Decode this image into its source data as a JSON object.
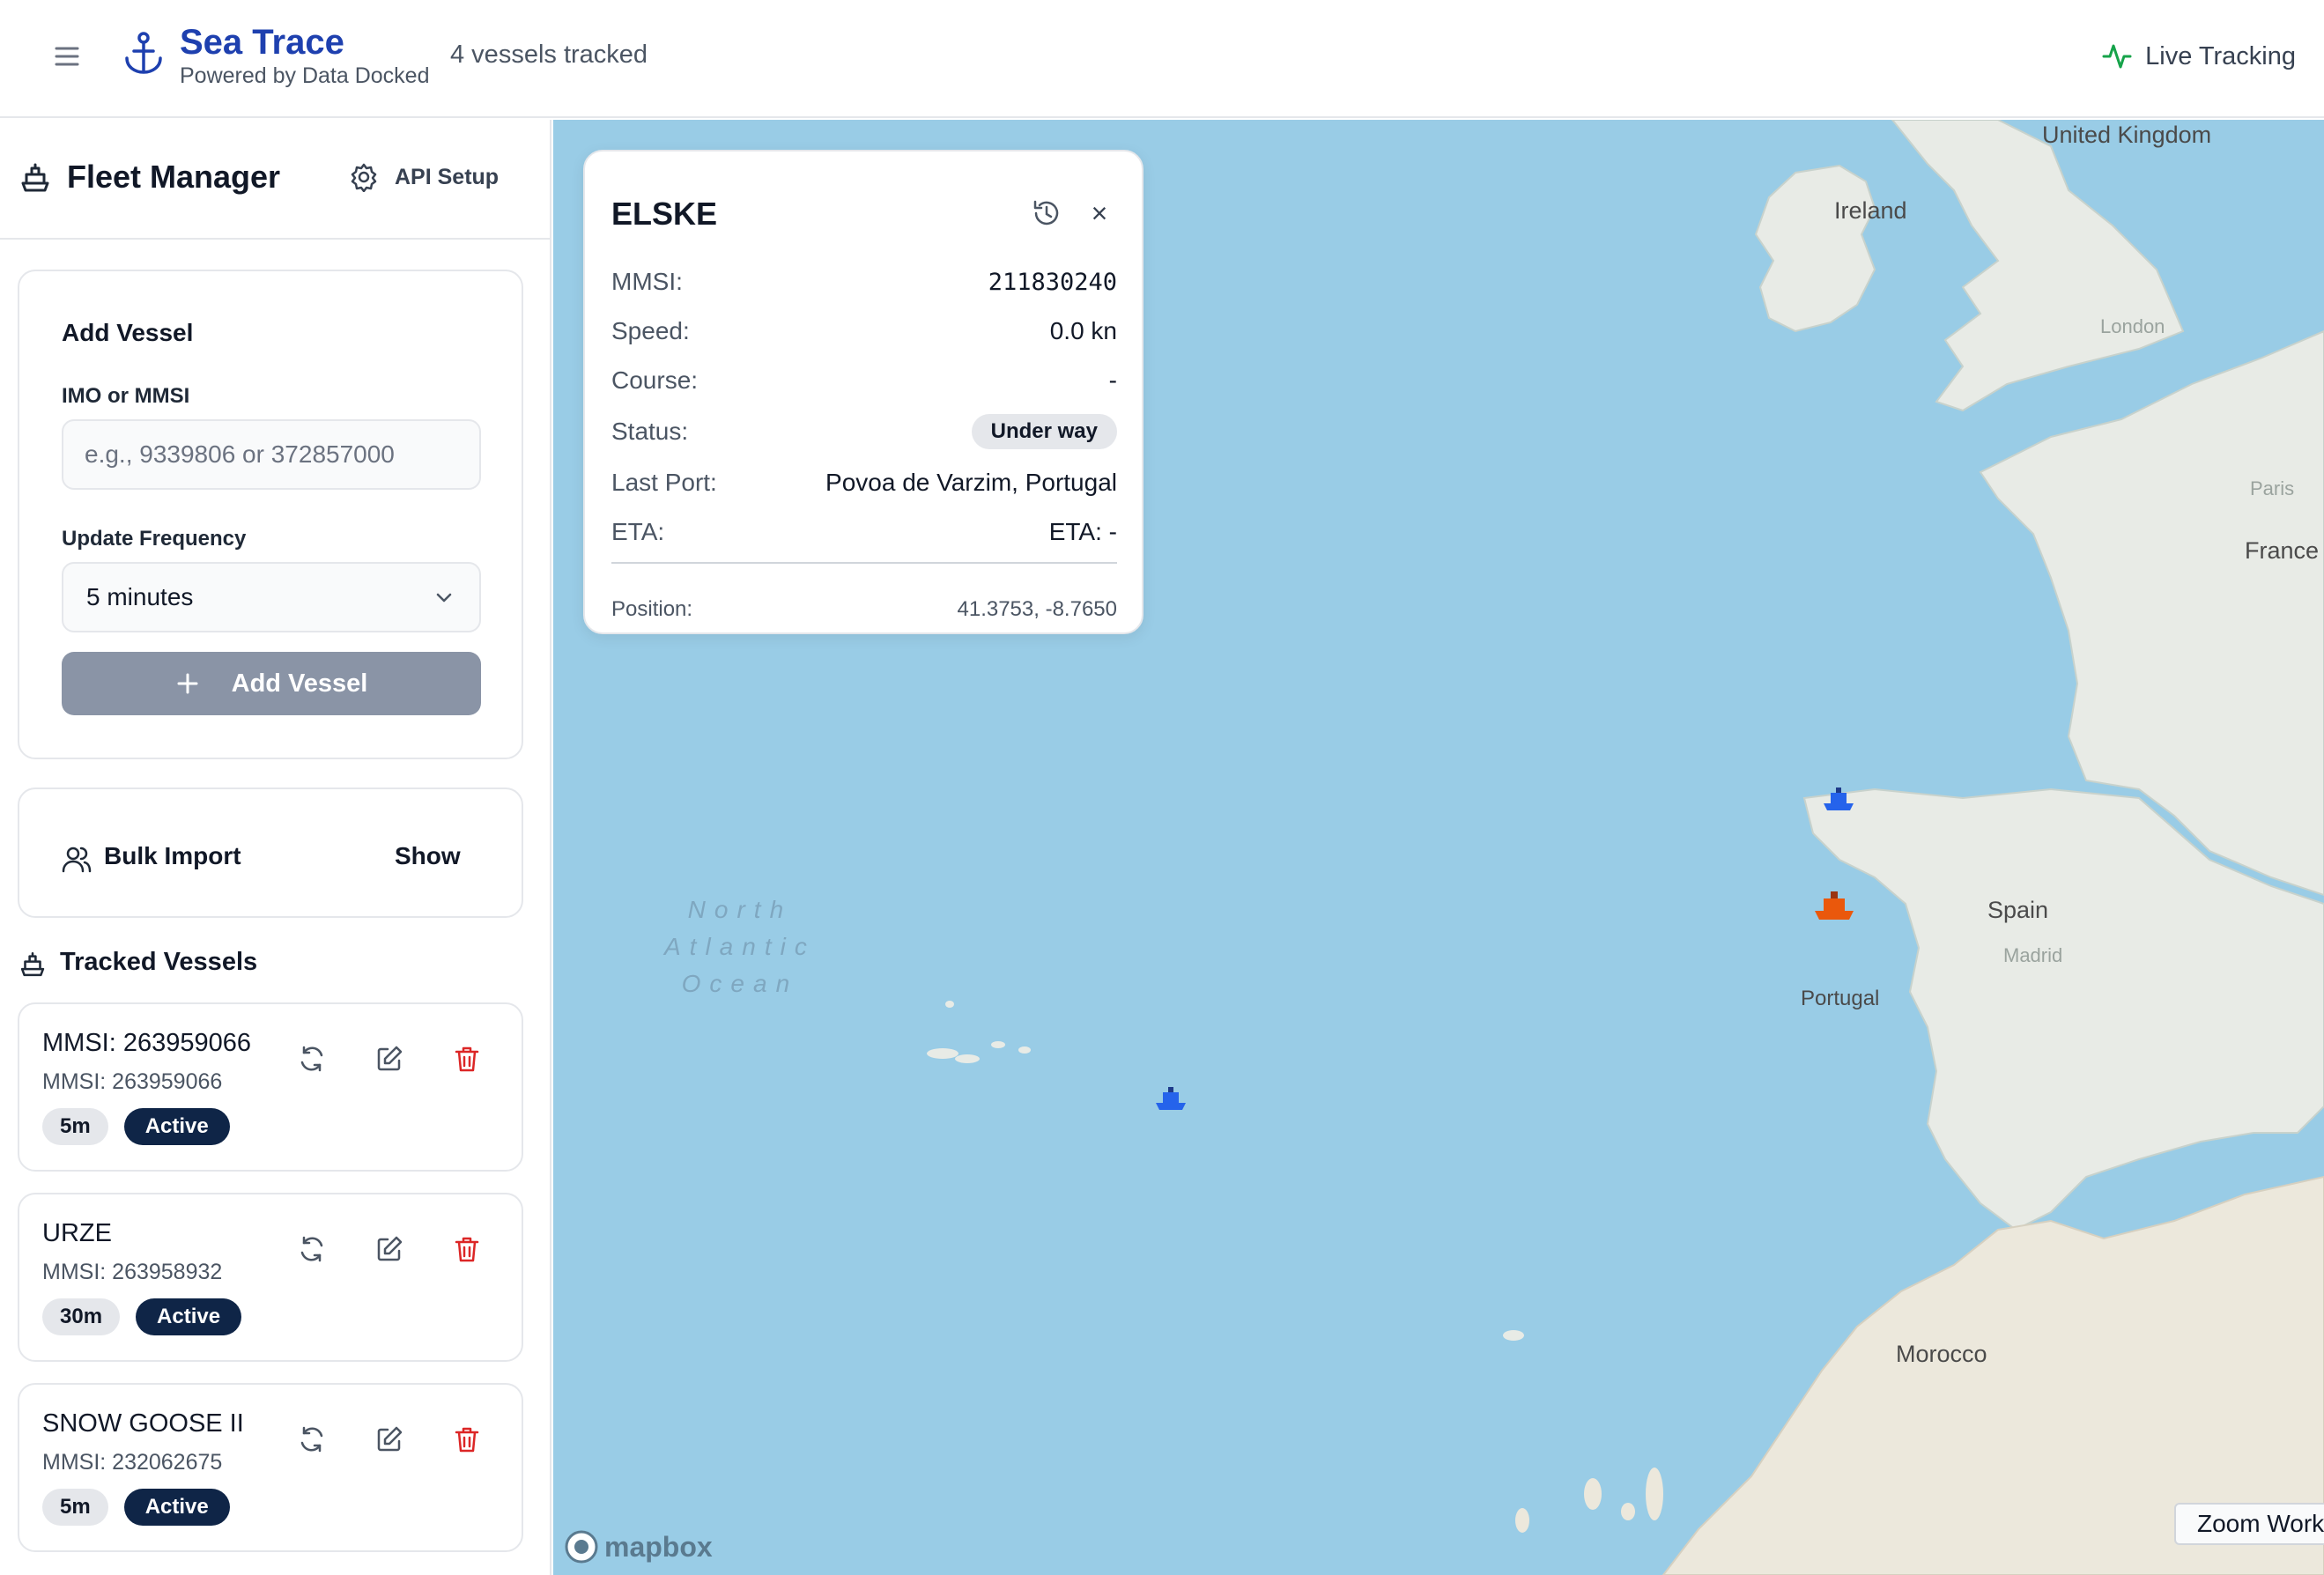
{
  "header": {
    "brand_title": "Sea Trace",
    "brand_subtitle": "Powered by Data Docked",
    "tracked_count": "4 vessels tracked",
    "live_label": "Live Tracking"
  },
  "sidebar": {
    "title": "Fleet Manager",
    "api_setup_label": "API Setup",
    "add_vessel": {
      "title": "Add Vessel",
      "imo_label": "IMO or MMSI",
      "imo_placeholder": "e.g., 9339806 or 372857000",
      "imo_value": "",
      "freq_label": "Update Frequency",
      "freq_value": "5 minutes",
      "button_label": "Add Vessel"
    },
    "bulk_import": {
      "title": "Bulk Import",
      "toggle_label": "Show"
    },
    "tracked_title": "Tracked Vessels",
    "vessels": [
      {
        "name": "MMSI: 263959066",
        "mmsi": "MMSI: 263959066",
        "freq": "5m",
        "status": "Active"
      },
      {
        "name": "URZE",
        "mmsi": "MMSI: 263958932",
        "freq": "30m",
        "status": "Active"
      },
      {
        "name": "SNOW GOOSE II",
        "mmsi": "MMSI: 232062675",
        "freq": "5m",
        "status": "Active"
      }
    ]
  },
  "popup": {
    "title": "ELSKE",
    "rows": [
      {
        "key": "MMSI:",
        "value": "211830240"
      },
      {
        "key": "Speed:",
        "value": "0.0 kn"
      },
      {
        "key": "Course:",
        "value": "-"
      },
      {
        "key": "Status:",
        "value": "Under way"
      },
      {
        "key": "Last Port:",
        "value": "Povoa de Varzim, Portugal"
      },
      {
        "key": "ETA:",
        "value": "ETA: -"
      }
    ],
    "position_key": "Position:",
    "position_value": "41.3753, -8.7650"
  },
  "map": {
    "labels": {
      "united_kingdom": "United Kingdom",
      "ireland": "Ireland",
      "france": "France",
      "spain": "Spain",
      "portugal": "Portugal",
      "morocco": "Morocco",
      "madrid": "Madrid",
      "paris": "Paris",
      "london": "London",
      "ocean_1": "North",
      "ocean_2": "Atlantic",
      "ocean_3": "Ocean"
    },
    "attribution": "mapbox",
    "zoom_label": "Zoom Work"
  },
  "colors": {
    "brand": "#1e40af",
    "water": "#99cce6",
    "land": "#e8ebe6",
    "active_badge": "#0f2547",
    "delete": "#dc2626",
    "vessel_blue": "#2563eb",
    "vessel_orange": "#ea580c",
    "live_green": "#16a34a"
  }
}
